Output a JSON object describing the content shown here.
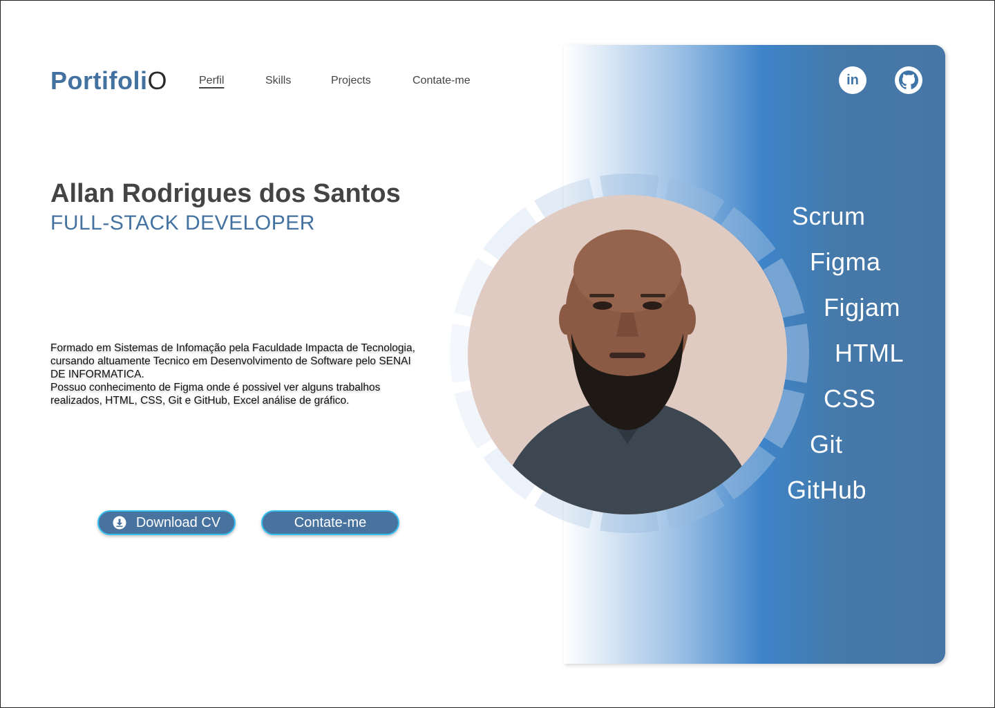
{
  "header": {
    "logo_main": "Portifoli",
    "logo_tail": "O",
    "nav": [
      "Perfil",
      "Skills",
      "Projects",
      "Contate-me"
    ],
    "social": {
      "linkedin_label": "in"
    }
  },
  "profile": {
    "name": "Allan Rodrigues dos Santos",
    "role": "FULL-STACK DEVELOPER",
    "bio_line1": "Formado em Sistemas de Infomação pela Faculdade Impacta de Tecnologia, cursando altuamente Tecnico em Desenvolvimento de Software pelo SENAI DE INFORMATICA.",
    "bio_line2": "Possuo conhecimento de Figma onde é possivel ver alguns trabalhos realizados, HTML, CSS, Git e GitHub, Excel análise de gráfico."
  },
  "buttons": {
    "download": "Download CV",
    "contact": "Contate-me"
  },
  "skills": [
    "Scrum",
    "Figma",
    "Figjam",
    "HTML",
    "CSS",
    "Git",
    "GitHub"
  ],
  "colors": {
    "accent": "#4472A0",
    "button": "#48739F",
    "button_border": "#35C0EF",
    "panel_blue": "#3E84C9"
  },
  "icons": {
    "linkedin": "linkedin-icon",
    "github": "github-icon",
    "download": "download-icon"
  }
}
